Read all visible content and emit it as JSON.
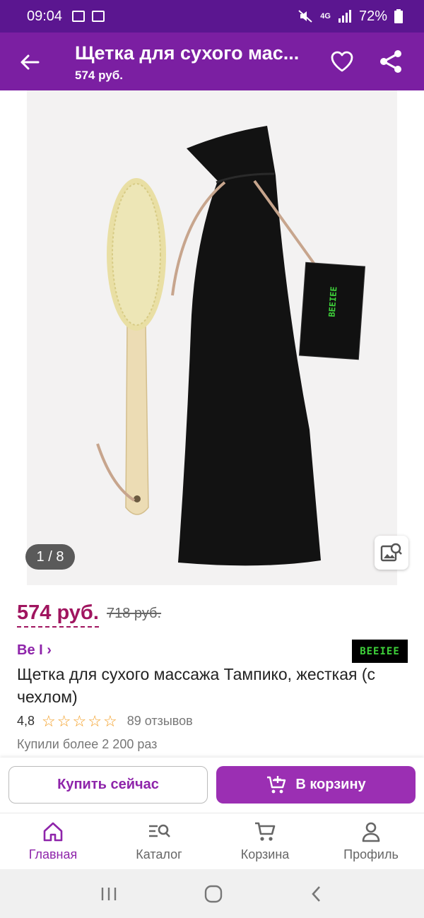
{
  "status_bar": {
    "time": "09:04",
    "network": "4G",
    "battery": "72%"
  },
  "app_bar": {
    "title": "Щетка для сухого мас...",
    "subtitle": "574 руб.",
    "icons": [
      "back-arrow-icon",
      "heart-icon",
      "share-icon"
    ]
  },
  "gallery": {
    "counter": "1 / 8",
    "tag_logo": "BEEIEE"
  },
  "product": {
    "price": "574 руб.",
    "old_price": "718 руб.",
    "brand": "Be I ›",
    "brand_logo": "BEEIEE",
    "title": "Щетка для сухого массажа Тампико, жесткая (с чехлом)",
    "rating": "4,8",
    "stars": 5,
    "reviews": "89 отзывов",
    "bought": "Купили более 2 200 раз"
  },
  "actions": {
    "buy_now": "Купить сейчас",
    "add_to_cart": "В корзину"
  },
  "bottom_nav": {
    "items": [
      {
        "label": "Главная",
        "icon": "home-icon",
        "active": true
      },
      {
        "label": "Каталог",
        "icon": "catalog-search-icon",
        "active": false
      },
      {
        "label": "Корзина",
        "icon": "cart-icon",
        "active": false
      },
      {
        "label": "Профиль",
        "icon": "profile-icon",
        "active": false
      }
    ]
  },
  "colors": {
    "status_bar": "#5b1690",
    "app_bar": "#7b1fa2",
    "price": "#a0155f",
    "accent": "#8e24aa",
    "cart_button": "#9b2fb3",
    "stars": "#f39c1f"
  }
}
